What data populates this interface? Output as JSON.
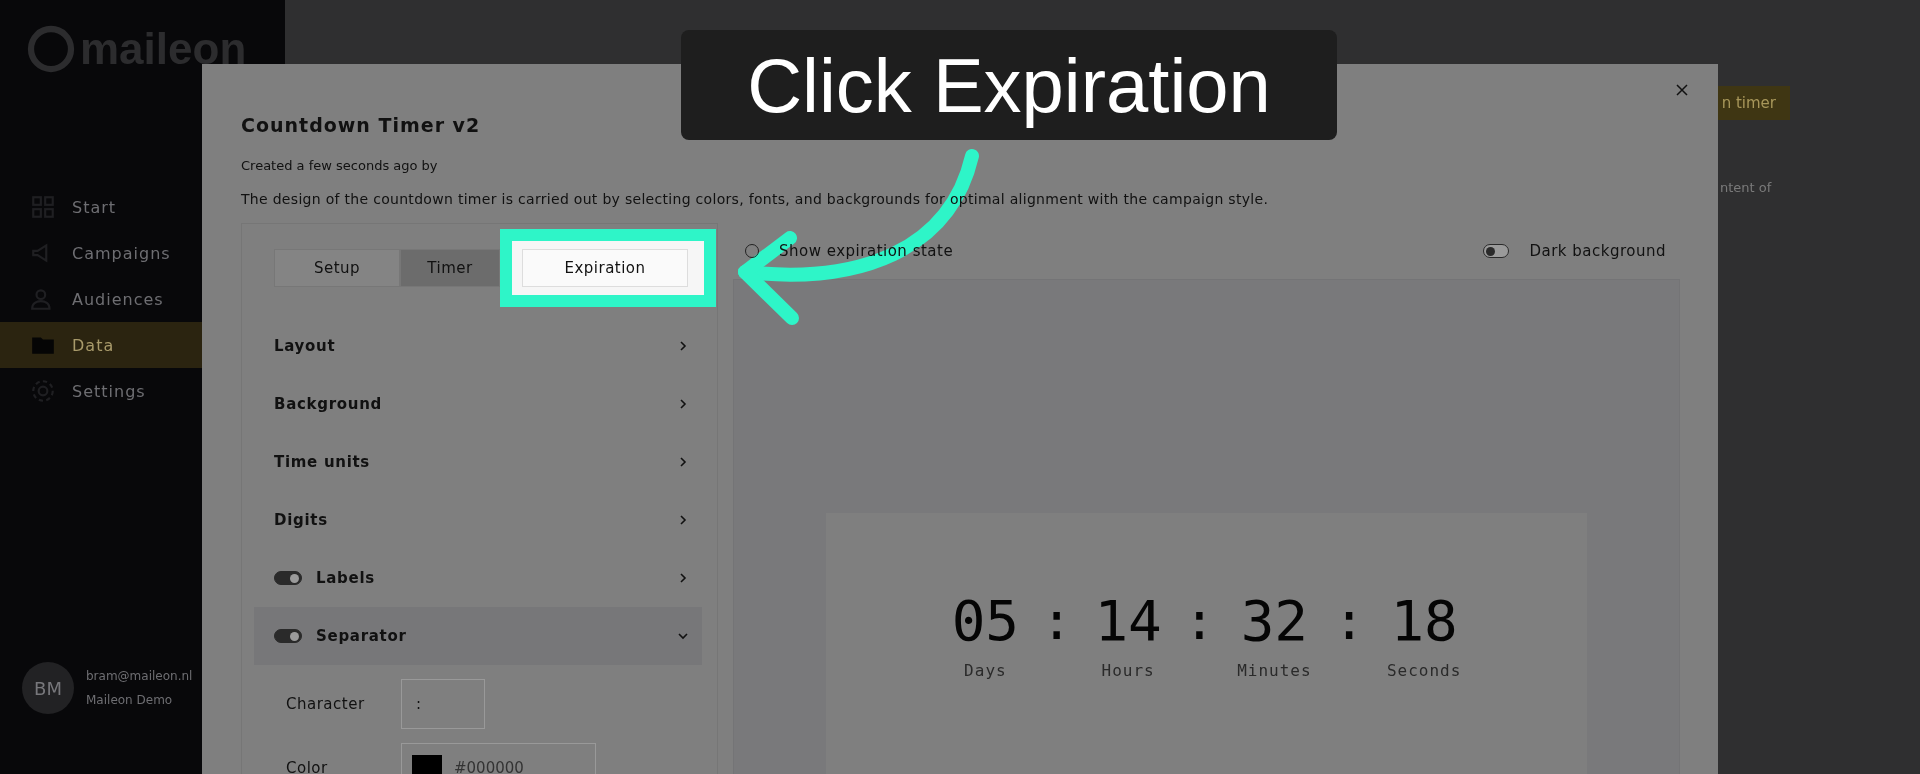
{
  "sidebar": {
    "logo": "maileon",
    "items": [
      {
        "label": "Start",
        "selected": false
      },
      {
        "label": "Campaigns",
        "selected": false
      },
      {
        "label": "Audiences",
        "selected": false
      },
      {
        "label": "Data",
        "selected": true
      },
      {
        "label": "Settings",
        "selected": false
      }
    ],
    "user": {
      "initials": "BM",
      "email": "bram@maileon.nl",
      "account": "Maileon Demo"
    }
  },
  "background_page": {
    "button": "n timer",
    "text": "ntent of"
  },
  "callout": {
    "text": "Click Expiration"
  },
  "modal": {
    "title": "Countdown Timer v2",
    "created": "Created a few seconds ago by",
    "description": "The design of the countdown timer is carried out by selecting colors, fonts, and backgrounds for optimal alignment with the campaign style.",
    "tabs": [
      {
        "label": "Setup",
        "selected": false,
        "highlighted": false
      },
      {
        "label": "Timer",
        "selected": true,
        "highlighted": false
      },
      {
        "label": "Expiration",
        "selected": false,
        "highlighted": true
      }
    ],
    "sections": [
      {
        "label": "Layout",
        "kind": "plain",
        "expanded": false
      },
      {
        "label": "Background",
        "kind": "plain",
        "expanded": false
      },
      {
        "label": "Time units",
        "kind": "plain",
        "expanded": false
      },
      {
        "label": "Digits",
        "kind": "plain",
        "expanded": false
      },
      {
        "label": "Labels",
        "kind": "toggle",
        "on": true,
        "expanded": false
      },
      {
        "label": "Separator",
        "kind": "toggle",
        "on": true,
        "expanded": true
      }
    ],
    "separator_fields": {
      "character": {
        "label": "Character",
        "value": ":"
      },
      "color": {
        "label": "Color",
        "value": "#000000"
      }
    },
    "preview": {
      "show_expiration_state": {
        "label": "Show expiration state",
        "checked": false
      },
      "dark_background": {
        "label": "Dark background",
        "on": false
      },
      "timer": [
        {
          "value": "05",
          "label": "Days"
        },
        {
          "value": "14",
          "label": "Hours"
        },
        {
          "value": "32",
          "label": "Minutes"
        },
        {
          "value": "18",
          "label": "Seconds"
        }
      ]
    }
  }
}
